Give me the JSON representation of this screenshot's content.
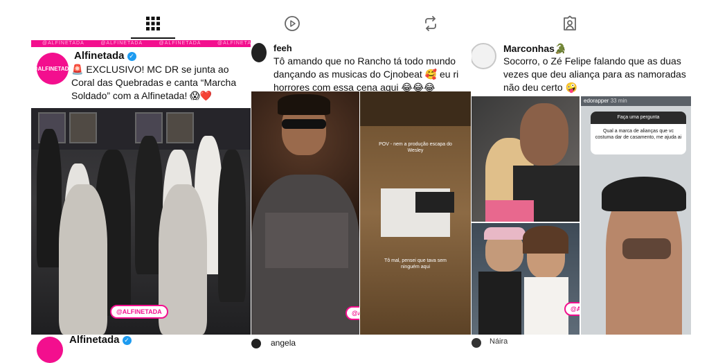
{
  "tabs": [
    {
      "name": "tab-grid",
      "icon": "grid-icon"
    },
    {
      "name": "tab-reels",
      "icon": "play-icon"
    },
    {
      "name": "tab-reposts",
      "icon": "repost-icon"
    },
    {
      "name": "tab-tagged",
      "icon": "tagged-icon"
    }
  ],
  "posts": [
    {
      "handle": "Alfinetada",
      "watermark": "@ALFINETADA",
      "logo_text": "@ALFINETADA",
      "text": "🚨 EXCLUSIVO! MC DR se junta ao Coral das Quebradas e canta “Marcha Soldado” com a Alfinetada! 😱❤️",
      "badge": "@ALFINETADA"
    },
    {
      "handle": "feeh",
      "text": "Tô amando que no Rancho tá todo mundo dançando as musicas do Cjnobeat 🥰 eu ri horrores com essa cena aqui 😂😂😂",
      "caption_top": "POV - nem a produção escapa do Wesley",
      "caption_bottom": "Tô mal, pensei que tava sem ninguém aqui",
      "badge": "@ALFINETADA"
    },
    {
      "handle": "Marconhas🐊",
      "text": "Socorro, o Zé Felipe falando que as duas vezes que deu aliança para as namoradas não deu certo 🤪",
      "story_user": "edorapper",
      "story_time": "33 min",
      "question_title": "Faça uma pergunta",
      "question": "Qual a marca de alianças que vc costuma dar de casamento, me ajuda ai",
      "badge": "@ALFINETADA"
    }
  ],
  "next_row": [
    {
      "handle": "Alfinetada"
    },
    {
      "handle": "angela"
    },
    {
      "handle": "Náira"
    }
  ],
  "colors": {
    "brand": "#f30f8e",
    "verified": "#1d9bf0"
  }
}
